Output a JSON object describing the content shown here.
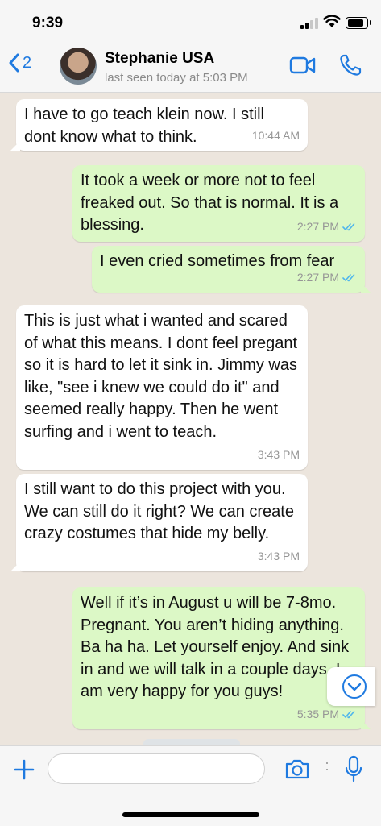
{
  "status_bar": {
    "time": "9:39"
  },
  "header": {
    "back_count": "2",
    "contact_name": "Stephanie USA",
    "last_seen": "last seen today at 5:03 PM"
  },
  "colors": {
    "accent": "#1f7ae0",
    "incoming_bubble": "#ffffff",
    "outgoing_bubble": "#dcf8c6",
    "chat_background": "#ece5dd",
    "read_ticks": "#4fb6ec"
  },
  "messages": [
    {
      "direction": "in",
      "text": "I have to go teach klein now. I still dont know what to think.",
      "time": "10:44 AM"
    },
    {
      "direction": "out",
      "text": "It took a week or more not to feel freaked out. So that is normal. It is a blessing.",
      "time": "2:27 PM",
      "status": "read"
    },
    {
      "direction": "out",
      "text": "I even cried sometimes from fear",
      "time": "2:27 PM",
      "status": "read"
    },
    {
      "direction": "in",
      "text": "This is just what i wanted and scared of what this means. I dont feel pregant so it is hard to let it sink in. Jimmy was like, \"see i knew we could do it\" and seemed really happy. Then he went surfing and i went to teach.",
      "time": "3:43 PM"
    },
    {
      "direction": "in",
      "text": "I still want to do this project with you. We can still do it right? We can create crazy costumes that hide my belly.",
      "time": "3:43 PM"
    },
    {
      "direction": "out",
      "text": "Well if it’s in August u will be 7-8mo. Pregnant. You aren’t hiding anything. Ba ha ha. Let yourself enjoy. And sink in and we will talk in a couple days. I am very happy for you guys!",
      "time": "5:35 PM",
      "status": "read"
    }
  ],
  "input": {
    "value": "",
    "placeholder": ""
  },
  "icons": {
    "back": "chevron-left-icon",
    "video": "video-camera-icon",
    "phone": "phone-icon",
    "plus": "plus-icon",
    "camera": "camera-icon",
    "mic": "microphone-icon",
    "scroll_down": "chevron-down-circle-icon"
  }
}
